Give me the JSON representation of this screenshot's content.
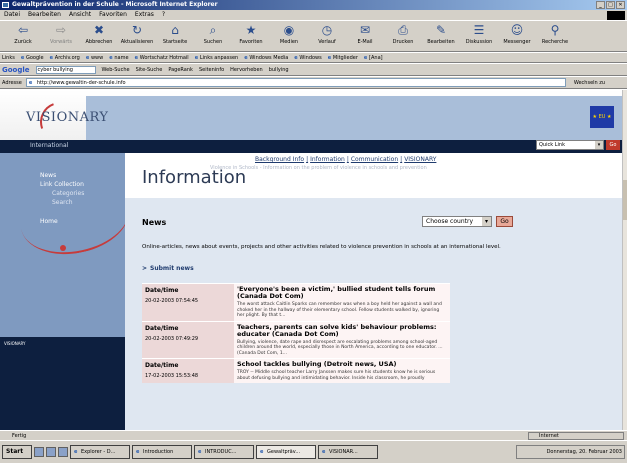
{
  "window": {
    "title": "Gewaltprävention in der Schule - Microsoft Internet Explorer"
  },
  "menu": [
    "Datei",
    "Bearbeiten",
    "Ansicht",
    "Favoriten",
    "Extras",
    "?"
  ],
  "toolbar": [
    {
      "label": "Zurück",
      "icon": "back-arrow-icon",
      "glyph": "⇦",
      "dim": false
    },
    {
      "label": "Vorwärts",
      "icon": "forward-arrow-icon",
      "glyph": "⇨",
      "dim": true
    },
    {
      "label": "Abbrechen",
      "icon": "stop-icon",
      "glyph": "✖",
      "dim": false
    },
    {
      "label": "Aktualisieren",
      "icon": "refresh-icon",
      "glyph": "↻",
      "dim": false
    },
    {
      "label": "Startseite",
      "icon": "home-icon",
      "glyph": "⌂",
      "dim": false
    },
    {
      "label": "Suchen",
      "icon": "search-icon",
      "glyph": "⌕",
      "dim": false
    },
    {
      "label": "Favoriten",
      "icon": "favorites-icon",
      "glyph": "★",
      "dim": false
    },
    {
      "label": "Medien",
      "icon": "media-icon",
      "glyph": "◉",
      "dim": false
    },
    {
      "label": "Verlauf",
      "icon": "history-icon",
      "glyph": "◷",
      "dim": false
    },
    {
      "label": "E-Mail",
      "icon": "mail-icon",
      "glyph": "✉",
      "dim": false
    },
    {
      "label": "Drucken",
      "icon": "print-icon",
      "glyph": "⎙",
      "dim": false
    },
    {
      "label": "Bearbeiten",
      "icon": "edit-icon",
      "glyph": "✎",
      "dim": false
    },
    {
      "label": "Diskussion",
      "icon": "discuss-icon",
      "glyph": "☰",
      "dim": false
    },
    {
      "label": "Messenger",
      "icon": "messenger-icon",
      "glyph": "☺",
      "dim": false
    },
    {
      "label": "Recherche",
      "icon": "research-icon",
      "glyph": "⚲",
      "dim": false
    }
  ],
  "links": {
    "label": "Links",
    "items": [
      "Google",
      "Archiv.org",
      "www",
      "name",
      "Wortschatz Hotmail",
      "Links anpassen",
      "Windows Media",
      "Windows",
      "Mitglieder",
      "[Ana]"
    ]
  },
  "google": {
    "logo": "Google",
    "query": "cyber bullying",
    "buttons": [
      "Web-Suche",
      "Site-Suche",
      "PageRank",
      "Seiteninfo",
      "Hervorheben",
      "bullying"
    ]
  },
  "address": {
    "label": "Adresse",
    "url": "http://www.gewaltin-der-schule.info",
    "go": "Wechseln zu"
  },
  "site": {
    "logo": "VISIONARY",
    "intl": "International",
    "eu": "★ EU ★",
    "quicklink": "Quick Link",
    "quick_go": "Go",
    "nav": [
      "Background Info",
      "Information",
      "Communication",
      "VISIONARY"
    ],
    "sidebar": [
      {
        "label": "News",
        "sub": false
      },
      {
        "label": "Link Collection",
        "sub": false
      },
      {
        "label": "Categories",
        "sub": true
      },
      {
        "label": "Search",
        "sub": true
      },
      {
        "label": "Home",
        "sub": false
      }
    ],
    "sidebar_tag": "VISIONARY",
    "page_title": "Information",
    "page_blurb": "Violence in Schools - Information on the problem of violence in schools and prevention",
    "news_heading": "News",
    "country_select": "Choose country",
    "country_go": "Go",
    "description": "Online-articles, news about events, projects and other activities related to violence prevention in schools at an international level.",
    "submit": "Submit news",
    "table": {
      "col_date": "Date/time",
      "rows": [
        {
          "date": "20-02-2003 07:54:45",
          "title": "'Everyone's been a victim,' bullied student tells forum (Canada Dot Com)",
          "body": "The worst attack Caitlin Sparks can remember was when a boy held her against a wall and choked her in the hallway of their elementary school. Fellow students walked by, ignoring her plight. By that t..."
        },
        {
          "date": "20-02-2003 07:49:29",
          "title": "Teachers, parents can solve kids' behaviour problems: educater (Canada Dot Com)",
          "body": "Bullying, violence, date rape and disrespect are escalating problems among school-aged children around the world, especially those in North America, according to one educator. ... (Canada Dot Com, 1..."
        },
        {
          "date": "17-02-2003 15:53:48",
          "title": "School tackles bullying (Detroit news, USA)",
          "body": "TROY -- Middle school teacher Larry Janssen makes sure his students know he is serious about defusing bullying and intimidating behavior. Inside his classroom, he proudly"
        }
      ]
    }
  },
  "status": {
    "left": "Fertig",
    "zone": "Internet"
  },
  "taskbar": {
    "start": "Start",
    "tasks": [
      "Explorer - D...",
      "Introduction",
      "INTRODUC...",
      "Gewaltpräv...",
      "VISIONAR..."
    ],
    "active_index": 3,
    "clock": "Donnerstag, 20. Februar 2003"
  }
}
